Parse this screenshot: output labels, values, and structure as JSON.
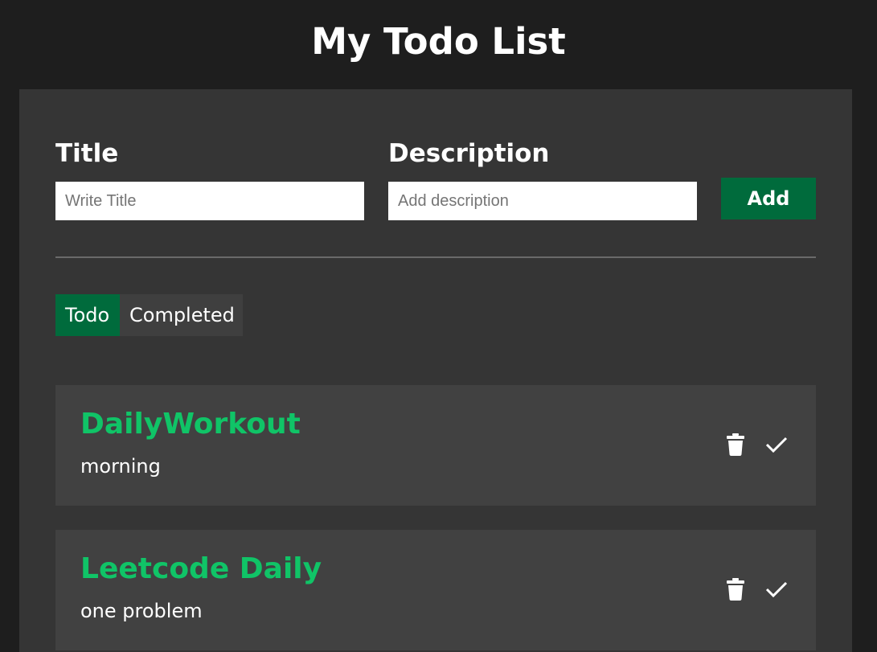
{
  "page": {
    "title": "My Todo List"
  },
  "form": {
    "title_label": "Title",
    "title_placeholder": "Write Title",
    "description_label": "Description",
    "description_placeholder": "Add description",
    "add_label": "Add"
  },
  "tabs": [
    {
      "label": "Todo",
      "active": true
    },
    {
      "label": "Completed",
      "active": false
    }
  ],
  "todos": [
    {
      "title": "DailyWorkout",
      "description": "morning"
    },
    {
      "title": "Leetcode Daily",
      "description": "one problem"
    }
  ],
  "colors": {
    "background": "#1e1e1e",
    "panel": "#353535",
    "card": "#414141",
    "accent": "#006b3c",
    "todo_title": "#10c467"
  },
  "icons": {
    "delete": "trash-icon",
    "complete": "check-icon"
  }
}
